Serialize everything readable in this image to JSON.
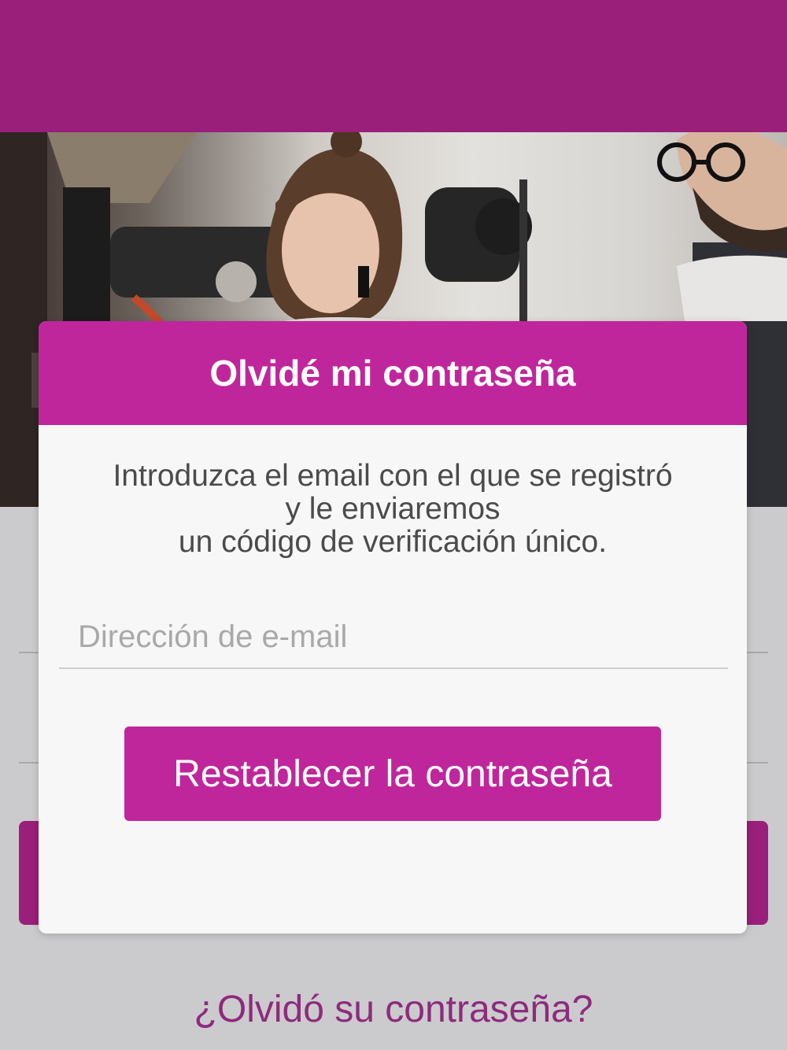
{
  "dialog": {
    "title": "Olvidé mi contraseña",
    "message_lines": [
      "Introduzca el email con el que se registró",
      "y le enviaremos",
      "un código de verificación único."
    ],
    "email_placeholder": "Dirección de e-mail",
    "email_value": "",
    "reset_button_label": "Restablecer la contraseña"
  },
  "background": {
    "forgot_link_label": "¿Olvidó su contraseña?"
  },
  "colors": {
    "brand_purple": "#9a1f7a",
    "accent_magenta": "#c0269c",
    "link_purple": "#8e2a7e"
  }
}
